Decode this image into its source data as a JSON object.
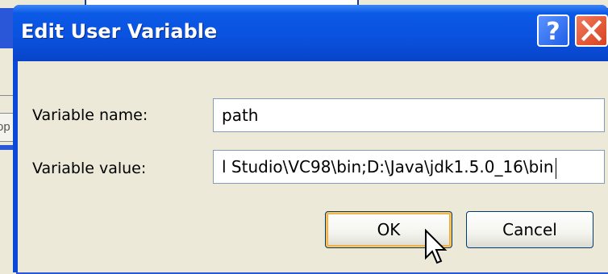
{
  "dialog": {
    "title": "Edit User Variable",
    "help_button": "?",
    "close_button": "X"
  },
  "form": {
    "name_label": "Variable name:",
    "name_value": "path",
    "value_label": "Variable value:",
    "value_value": "l Studio\\VC98\\bin;D:\\Java\\jdk1.5.0_16\\bin"
  },
  "buttons": {
    "ok": "OK",
    "cancel": "Cancel"
  },
  "background": {
    "partial_text": "op"
  },
  "icons": {
    "help": "help-icon",
    "close": "close-icon",
    "cursor": "mouse-pointer-icon"
  },
  "colors": {
    "titlebar": "#0a52e0",
    "dialog_body": "#ece9d8",
    "close_button": "#d8421f",
    "default_button_highlight": "#f6c453"
  }
}
